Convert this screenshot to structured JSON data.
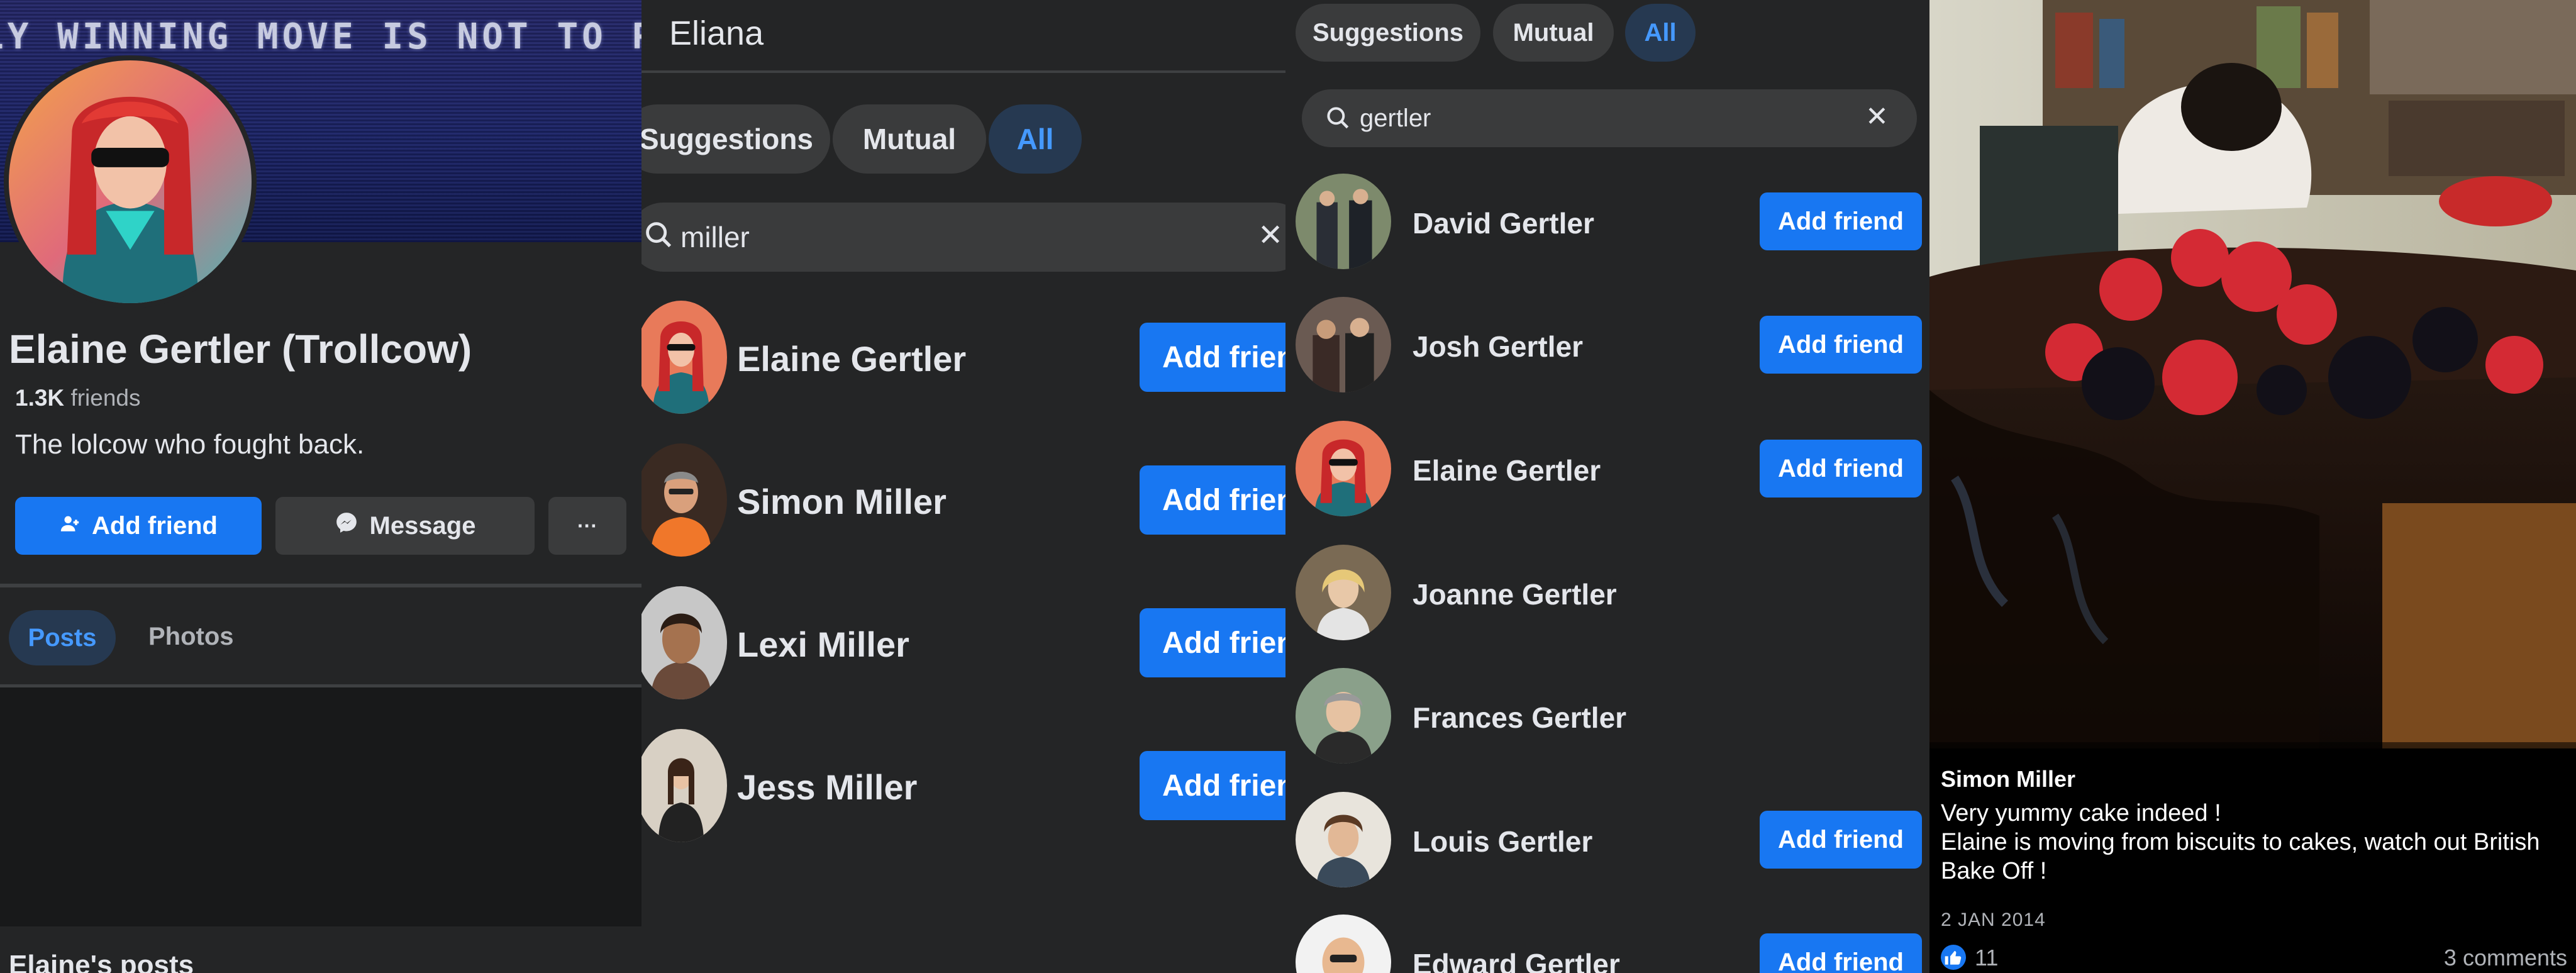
{
  "profile": {
    "cover_text": "LY WINNING MOVE IS NOT TO PLA",
    "name": "Elaine Gertler (Trollcow)",
    "friend_count": "1.3K",
    "friends_label": "friends",
    "bio": "The lolcow who fought back.",
    "add_friend_label": "Add friend",
    "message_label": "Message",
    "more_label": "···",
    "tabs": [
      "Posts",
      "Photos"
    ],
    "section_title": "Elaine's posts"
  },
  "search_miller": {
    "title": "Eliana",
    "chips": [
      "Suggestions",
      "Mutual",
      "All"
    ],
    "query": "miller",
    "clear": "✕",
    "results": [
      {
        "name": "Elaine Gertler",
        "button": "Add friend"
      },
      {
        "name": "Simon Miller",
        "button": "Add friend"
      },
      {
        "name": "Lexi Miller",
        "button": "Add friend"
      },
      {
        "name": "Jess Miller",
        "button": "Add friend"
      }
    ]
  },
  "search_gertler": {
    "chips": [
      "Suggestions",
      "Mutual",
      "All"
    ],
    "query": "gertler",
    "clear": "✕",
    "results": [
      {
        "name": "David Gertler",
        "button": "Add friend"
      },
      {
        "name": "Josh Gertler",
        "button": "Add friend"
      },
      {
        "name": "Elaine Gertler",
        "button": "Add friend"
      },
      {
        "name": "Joanne Gertler",
        "button": ""
      },
      {
        "name": "Frances Gertler",
        "button": ""
      },
      {
        "name": "Louis Gertler",
        "button": "Add friend"
      },
      {
        "name": "Edward Gertler",
        "button": "Add friend"
      }
    ]
  },
  "photo_post": {
    "author": "Simon Miller",
    "caption_line1": "Very yummy cake indeed !",
    "caption_line2": "Elaine is moving from biscuits to cakes, watch out British Bake Off !",
    "date": "2 JAN 2014",
    "likes": "11",
    "comments": "3 comments"
  },
  "colors": {
    "background": "#242526",
    "accent": "#1877f2",
    "active_chip_text": "#4599ff",
    "chip_bg": "#3a3b3c"
  },
  "icons": [
    "add-person-icon",
    "messenger-icon",
    "search-icon",
    "close-icon",
    "like-icon"
  ]
}
